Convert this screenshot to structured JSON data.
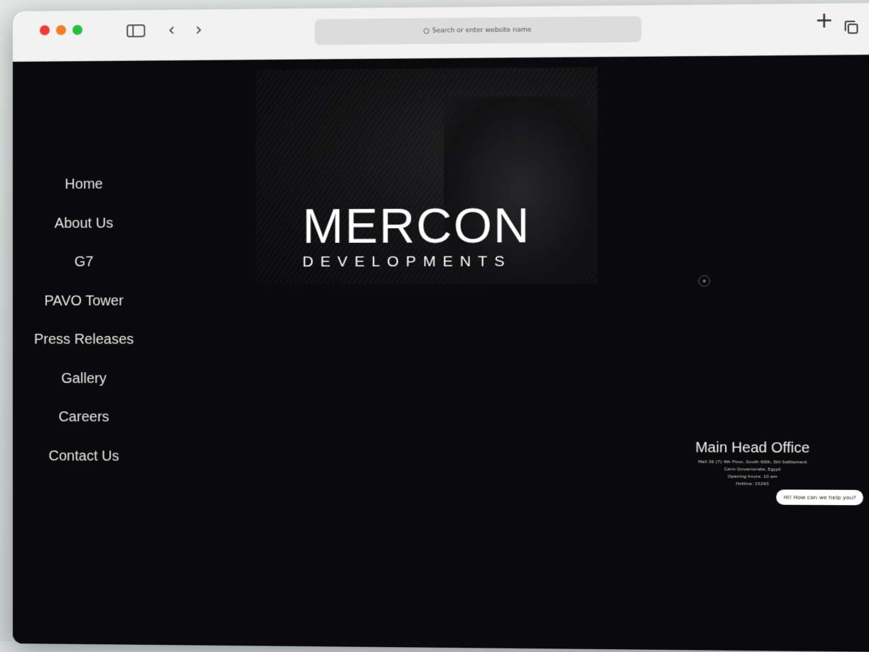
{
  "browser": {
    "address_placeholder": "Search or enter website name",
    "plus_label": "+",
    "back_label": "‹",
    "forward_label": "›"
  },
  "overlay": {
    "close_label": "✕"
  },
  "nav": {
    "items": [
      {
        "label": "Home"
      },
      {
        "label": "About Us"
      },
      {
        "label": "G7"
      },
      {
        "label": "PAVO Tower"
      },
      {
        "label": "Press Releases"
      },
      {
        "label": "Gallery"
      },
      {
        "label": "Careers"
      },
      {
        "label": "Contact Us"
      }
    ]
  },
  "logo": {
    "main": "MERCON",
    "sub": "DEVELOPMENTS"
  },
  "office": {
    "title": "Main Head Office",
    "lines": [
      "Mall 36 (7) 4th Floor, South 90th, 5th Settlement",
      "Cairo Governorate, Egypt",
      "Opening hours: 10 am",
      "Hotline: 15293"
    ]
  },
  "chat": {
    "bubble_text": "Hi! How can we help you?",
    "close_label": "×"
  },
  "colors": {
    "background": "#0a0a0c",
    "text": "#e9e9e9",
    "traffic_red": "#ef3b33",
    "traffic_orange": "#f07d27",
    "traffic_green": "#27c03d"
  }
}
